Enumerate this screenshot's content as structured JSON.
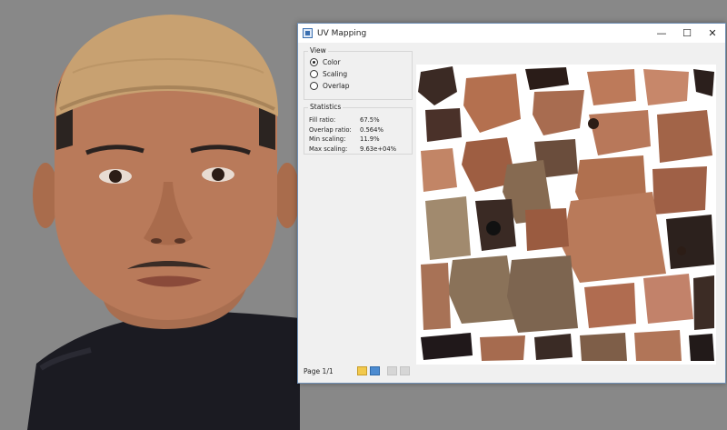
{
  "window": {
    "title": "UV Mapping",
    "controls": {
      "minimize": "—",
      "maximize": "☐",
      "close": "✕"
    }
  },
  "view": {
    "group_label": "View",
    "options": [
      {
        "label": "Color",
        "selected": true
      },
      {
        "label": "Scaling",
        "selected": false
      },
      {
        "label": "Overlap",
        "selected": false
      }
    ]
  },
  "statistics": {
    "group_label": "Statistics",
    "rows": [
      {
        "label": "Fill ratio:",
        "value": "67.5%"
      },
      {
        "label": "Overlap ratio:",
        "value": "0.564%"
      },
      {
        "label": "Min scaling:",
        "value": "11.9%"
      },
      {
        "label": "Max scaling:",
        "value": "9.63e+04%"
      }
    ]
  },
  "footer": {
    "page_label": "Page 1/1",
    "icons": [
      "open-folder-icon",
      "save-icon",
      "prev-page-icon",
      "next-page-icon"
    ]
  },
  "colors": {
    "viewport_bg": "#888888",
    "window_border": "#6f8fb5",
    "skin": "#b97a5a",
    "cap": "#c8a171"
  }
}
